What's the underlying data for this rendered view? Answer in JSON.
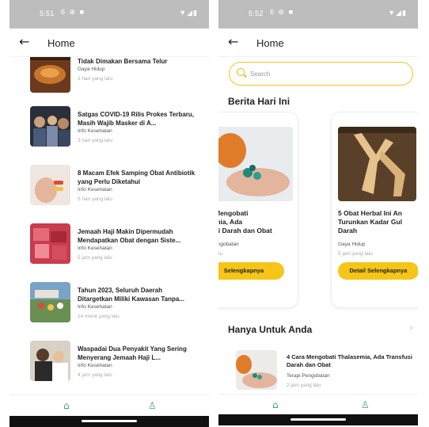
{
  "phone1": {
    "status": {
      "time": "5:51",
      "icons": [
        "6",
        "⊕",
        "■"
      ],
      "right": "▼◢▮"
    },
    "appbar": {
      "back": "←",
      "title": "Home"
    },
    "items": [
      {
        "title": "Tidak Dimakan Bersama Telur",
        "category": "Gaya Hidup",
        "time": "1 hari yang lalu"
      },
      {
        "title": "Satgas COVID-19 Rilis Prokes Terbaru, Masih Wajib Masker di A...",
        "category": "Info Kesehatan",
        "time": "3 hari yang lalu"
      },
      {
        "title": "8 Macam Efek Samping Obat Antibiotik yang Perlu Diketahui",
        "category": "Info Kesehatan",
        "time": "5 hari yang lalu"
      },
      {
        "title": "Jemaah Haji Makin Dipermudah Mendapatkan Obat dengan Siste...",
        "category": "Info Kesehatan",
        "time": "5 jam yang lalu"
      },
      {
        "title": "Tahun 2023, Seluruh Daerah Ditargetkan Miliki Kawasan Tanpa...",
        "category": "Info Kesehatan",
        "time": "14 menit yang lalu"
      },
      {
        "title": "Waspadai Dua Penyakit Yang Sering Menyerang Jemaah Haji L...",
        "category": "Info Kesehatan",
        "time": "4 jam yang lalu"
      }
    ],
    "nav": {
      "home": "⌂",
      "profile": "♙"
    }
  },
  "phone2": {
    "status": {
      "time": "5:52",
      "icons": [
        "6",
        "⊕",
        "■"
      ],
      "right": "▼◢▮"
    },
    "appbar": {
      "back": "←",
      "title": "Home"
    },
    "search": {
      "placeholder": "Search"
    },
    "section1": "Berita Hari Ini",
    "cards": [
      {
        "title": "Mengobati\nmia, Ada\nsi Darah dan Obat",
        "category": "engobatan",
        "time": "lalu",
        "button": "Selengkapnya"
      },
      {
        "title": "5 Obat Herbal Ini An\nTurunkan Kadar Gul\nDarah",
        "category": "Gaya Hidup",
        "time": "5 jam yang lalu",
        "button": "Detail Selengkapnya"
      }
    ],
    "section2": "Hanya Untuk Anda",
    "section2_arrow": "›",
    "small": {
      "title": "4 Cara Mengobati Thalasemia, Ada Transfusi Darah dan Obat",
      "category": "Terapi Pengobatan",
      "time": "2 jam yang lalu"
    },
    "nav": {
      "home": "⌂",
      "profile": "♙"
    }
  }
}
